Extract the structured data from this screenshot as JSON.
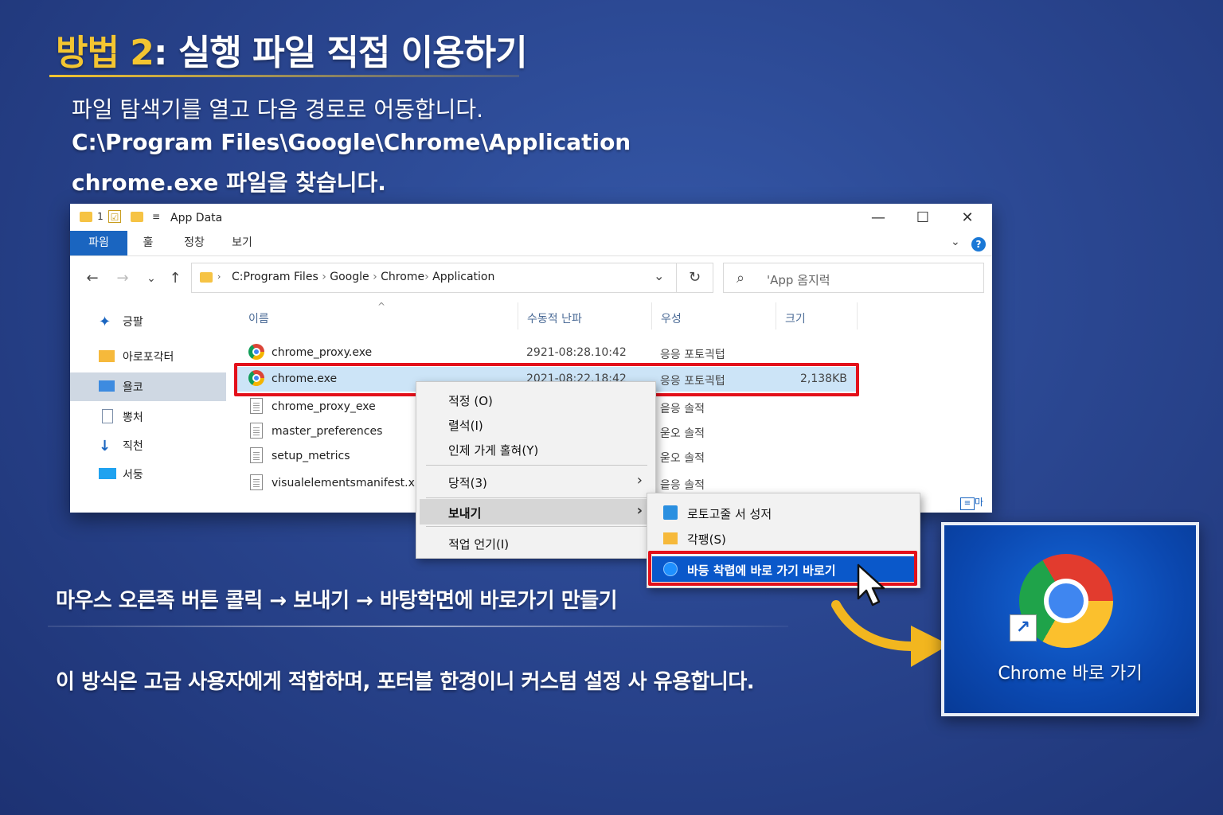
{
  "title": {
    "prefix": "방법 2",
    "rest": ": 실행 파일 직접 이용하기"
  },
  "intro": {
    "line1": "파일 탐색기를 열고 다음 경로로 어동합니다.",
    "line2": "C:\\Program Files\\Google\\Chrome\\Application",
    "line3": "chrome.exe 파일을 찾습니다."
  },
  "explorer": {
    "window_title": "App Data",
    "qat_number": "1",
    "ribbon_tabs": [
      "파읨",
      "훌",
      "정창",
      "보기"
    ],
    "help_label": "?",
    "address": {
      "separator": "›",
      "crumbs": [
        "C:Program  Files",
        "Google",
        "Chrome",
        "Application"
      ]
    },
    "search_placeholder": "'App 옴지럭",
    "sidebar": [
      {
        "label": "긍팔",
        "icon": "pin-icon"
      },
      {
        "label": "아로포각터",
        "icon": "folder-icon"
      },
      {
        "label": "욜코",
        "icon": "desktop-icon"
      },
      {
        "label": "뽕처",
        "icon": "document-icon"
      },
      {
        "label": "직천",
        "icon": "download-icon"
      },
      {
        "label": "서둥",
        "icon": "monitor-icon"
      }
    ],
    "columns": [
      "이름",
      "수동적 난파",
      "우성",
      "크기"
    ],
    "files": [
      {
        "name": "chrome_proxy.exe",
        "modified": "2921-08:28.10:42",
        "type": "응응 포토긕텁",
        "size": "",
        "icon": "chrome-icon"
      },
      {
        "name": "chrome.exe",
        "modified": "2021-08:22.18:42",
        "type": "응응 포토긕텁",
        "size": "2,138KB",
        "icon": "chrome-icon"
      },
      {
        "name": "chrome_proxy_exe",
        "modified": "",
        "type": "읕응 솔적",
        "size": "",
        "icon": "file-icon"
      },
      {
        "name": "master_preferences",
        "modified": "",
        "type": "욷오 솔적",
        "size": "",
        "icon": "file-icon"
      },
      {
        "name": "setup_metrics",
        "modified": "",
        "type": "욷오 솔적",
        "size": "",
        "icon": "file-icon"
      },
      {
        "name": "visualelementsmanifest.xml",
        "modified": "",
        "type": "읕응 솔적",
        "size": "",
        "icon": "file-icon"
      }
    ],
    "view_toggle": "마"
  },
  "context_menu": {
    "items": [
      "적정 (O)",
      "렬석(I)",
      "인제 가게 홀혀(Y)",
      "당적(3)",
      "보내기",
      "적업 언기(I)"
    ]
  },
  "send_to_menu": {
    "items": [
      "로토고줄 서 성저",
      "각팽(S)",
      "바등 착렵에 바로 가기 바로기"
    ]
  },
  "step_text": "마우스 오른족 버튼 콜릭 → 보내기 → 바탕학면에 바로가기 만들기",
  "note_text": "이 방식은 고급 사용자에게 적합하며, 포터블 한경이니 커스텀 설정 사 유용합니다.",
  "shortcut_tile": {
    "label": "Chrome 바로 가기"
  },
  "colors": {
    "accent_yellow": "#f3c531",
    "highlight_red": "#e3101a",
    "windows_blue": "#1a65c0"
  }
}
